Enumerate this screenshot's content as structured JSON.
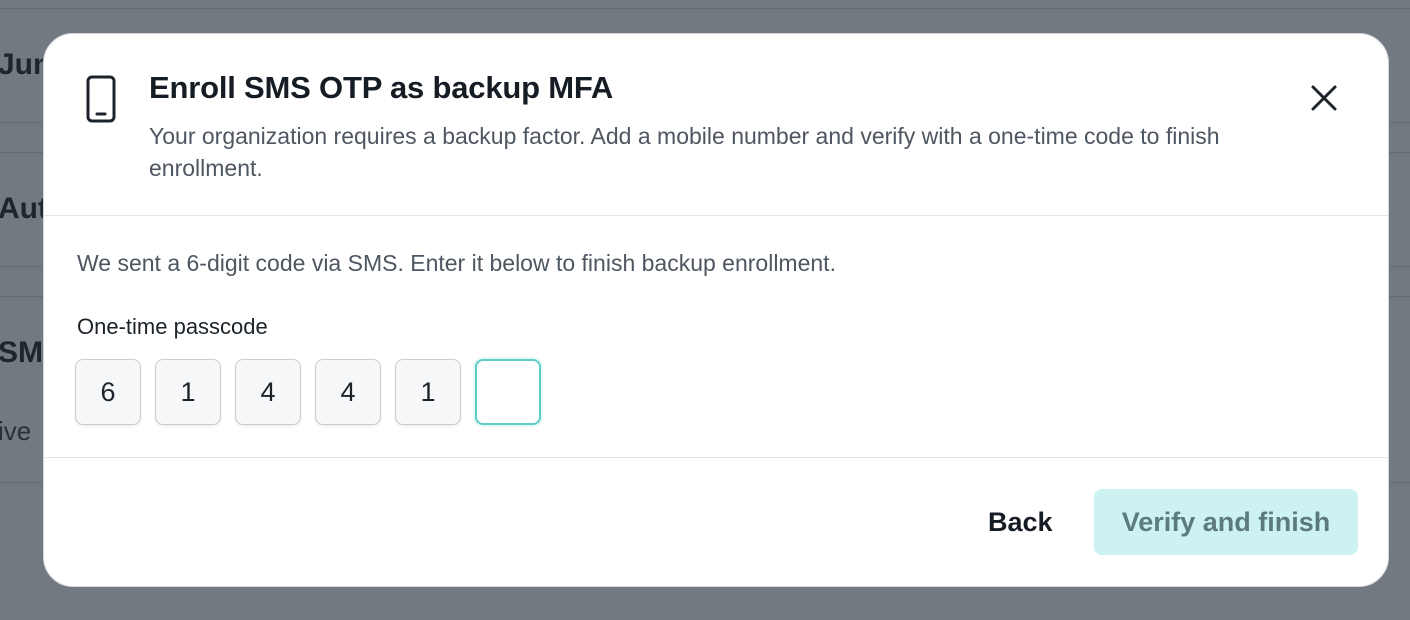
{
  "background": {
    "fragments": [
      "Jun",
      "Aut",
      "SMS",
      "ive"
    ]
  },
  "modal": {
    "icon": "phone-icon",
    "title": "Enroll SMS OTP as backup MFA",
    "description": "Your organization requires a backup factor. Add a mobile number and verify with a one-time code to finish enrollment.",
    "close_icon": "close-icon"
  },
  "body": {
    "instruction": "We sent a 6-digit code via SMS. Enter it below to finish backup enrollment.",
    "field_label": "One-time passcode",
    "otp_digits": [
      "6",
      "1",
      "4",
      "4",
      "1",
      ""
    ],
    "active_index": 5
  },
  "footer": {
    "back_label": "Back",
    "verify_label": "Verify and finish"
  },
  "colors": {
    "overlay": "#727981",
    "accent_focus": "#5fcfc6",
    "primary_disabled_bg": "#ccf3f2",
    "primary_disabled_text": "#5c7a80"
  }
}
